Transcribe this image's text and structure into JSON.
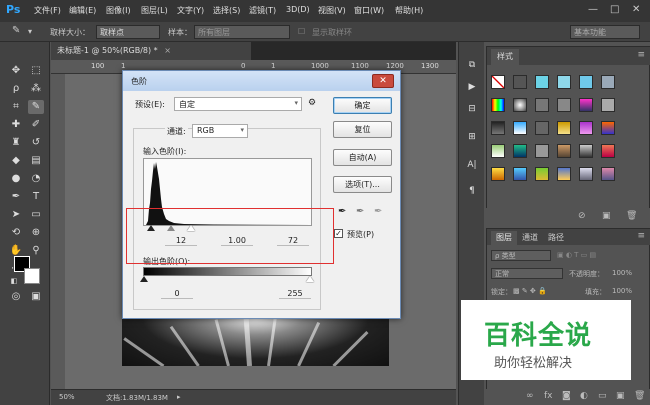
{
  "menubar": {
    "logo": "Ps",
    "items": [
      "文件(F)",
      "编辑(E)",
      "图像(I)",
      "图层(L)",
      "文字(Y)",
      "选择(S)",
      "滤镜(T)",
      "3D(D)",
      "视图(V)",
      "窗口(W)",
      "帮助(H)"
    ],
    "minimize": "—",
    "maximize": "□",
    "close": "✕"
  },
  "options": {
    "sample_size_label": "取样大小：",
    "sample_size_value": "取样点",
    "sample_label": "样本：",
    "sample_value": "所有图层",
    "show_ring": "显示取样环",
    "workspace": "基本功能"
  },
  "document": {
    "tab_title": "未标题-1 @ 50%(RGB/8) *",
    "tab_close": "×",
    "ruler_ticks": [
      "100",
      "1",
      "0",
      "1",
      "1000",
      "1100",
      "1200",
      "1300"
    ],
    "zoom": "50%",
    "doc_info": "文档:1.83M/1.83M"
  },
  "styles_panel": {
    "tab": "样式",
    "footer_icons": [
      "⊘",
      "▣",
      "🗑"
    ]
  },
  "layers_panel": {
    "tabs": [
      "图层",
      "通道",
      "路径"
    ],
    "kind_label": "ρ 类型",
    "blend_mode": "正常",
    "opacity_label": "不透明度：",
    "opacity_value": "100%",
    "lock_label": "锁定：",
    "fill_label": "填充：",
    "fill_value": "100%",
    "footer_icons": [
      "∞",
      "fx",
      "◙",
      "◐",
      "▭",
      "▣",
      "🗑"
    ]
  },
  "levels_dialog": {
    "title": "色阶",
    "close_glyph": "✕",
    "preset_label": "预设(E):",
    "preset_value": "自定",
    "channel_label": "通道:",
    "channel_value": "RGB",
    "input_levels_label": "输入色阶(I):",
    "input_black": "12",
    "input_gamma": "1.00",
    "input_white": "72",
    "output_levels_label": "输出色阶(O):",
    "output_black": "0",
    "output_white": "255",
    "ok_button": "确定",
    "reset_button": "复位",
    "auto_button": "自动(A)",
    "options_button": "选项(T)...",
    "preview_label": "预览(P)",
    "preview_check": "✓"
  },
  "watermark": {
    "title": "百科全说",
    "subtitle": "助你轻松解决"
  },
  "colors": {
    "accent_blue": "#31a8ff",
    "highlight_red": "#e03030",
    "watermark_green": "#2aa84a"
  }
}
